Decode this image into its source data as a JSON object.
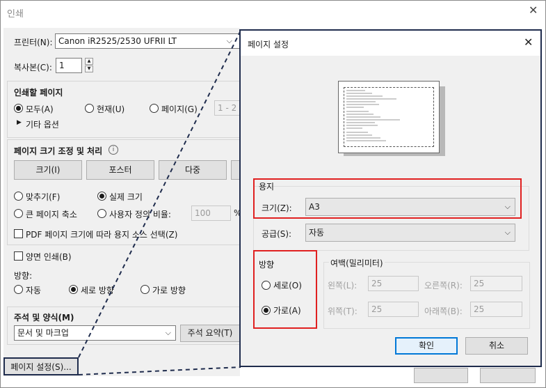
{
  "window": {
    "title": "인쇄"
  },
  "printer": {
    "label": "프린터(N):",
    "value": "Canon iR2525/2530 UFRII LT"
  },
  "copies": {
    "label": "복사본(C):",
    "value": "1"
  },
  "pages": {
    "title": "인쇄할 페이지",
    "all": "모두(A)",
    "current": "현재(U)",
    "range": "페이지(G)",
    "range_value": "1 - 2",
    "more": "기타 옵션"
  },
  "sizing": {
    "title": "페이지 크기 조정 및 처리",
    "buttons": [
      "크기(I)",
      "포스터",
      "다중"
    ],
    "fit": "맞추기(F)",
    "actual": "실제 크기",
    "shrink": "큰 페이지 축소",
    "custom": "사용자 정의 비율:",
    "custom_value": "100",
    "percent": "%",
    "pdf_source": "PDF 페이지 크기에 따라 용지 소스 선택(Z)"
  },
  "duplex": {
    "label": "양면 인쇄(B)"
  },
  "orientation": {
    "label": "방향:",
    "auto": "자동",
    "portrait": "세로 방향",
    "landscape": "가로 방향"
  },
  "comments": {
    "title": "주석 및 양식(M)",
    "value": "문서 및 마크업",
    "summary": "주석 요약(T)"
  },
  "page_setup_button": "페이지 설정(S)...",
  "dialog": {
    "title": "페이지 설정",
    "paper": {
      "title": "용지",
      "size_label": "크기(Z):",
      "size_value": "A3",
      "source_label": "공급(S):",
      "source_value": "자동"
    },
    "orientation": {
      "title": "방향",
      "portrait": "세로(O)",
      "landscape": "가로(A)"
    },
    "margins": {
      "title": "여백(밀리미터)",
      "left_label": "왼쪽(L):",
      "left_value": "25",
      "right_label": "오른쪽(R):",
      "right_value": "25",
      "top_label": "위쪽(T):",
      "top_value": "25",
      "bottom_label": "아래쪽(B):",
      "bottom_value": "25"
    },
    "ok": "확인",
    "cancel": "취소"
  },
  "colors": {
    "accent": "#0078d7",
    "highlight": "#e02020",
    "dialog_border": "#1f2c4d"
  }
}
